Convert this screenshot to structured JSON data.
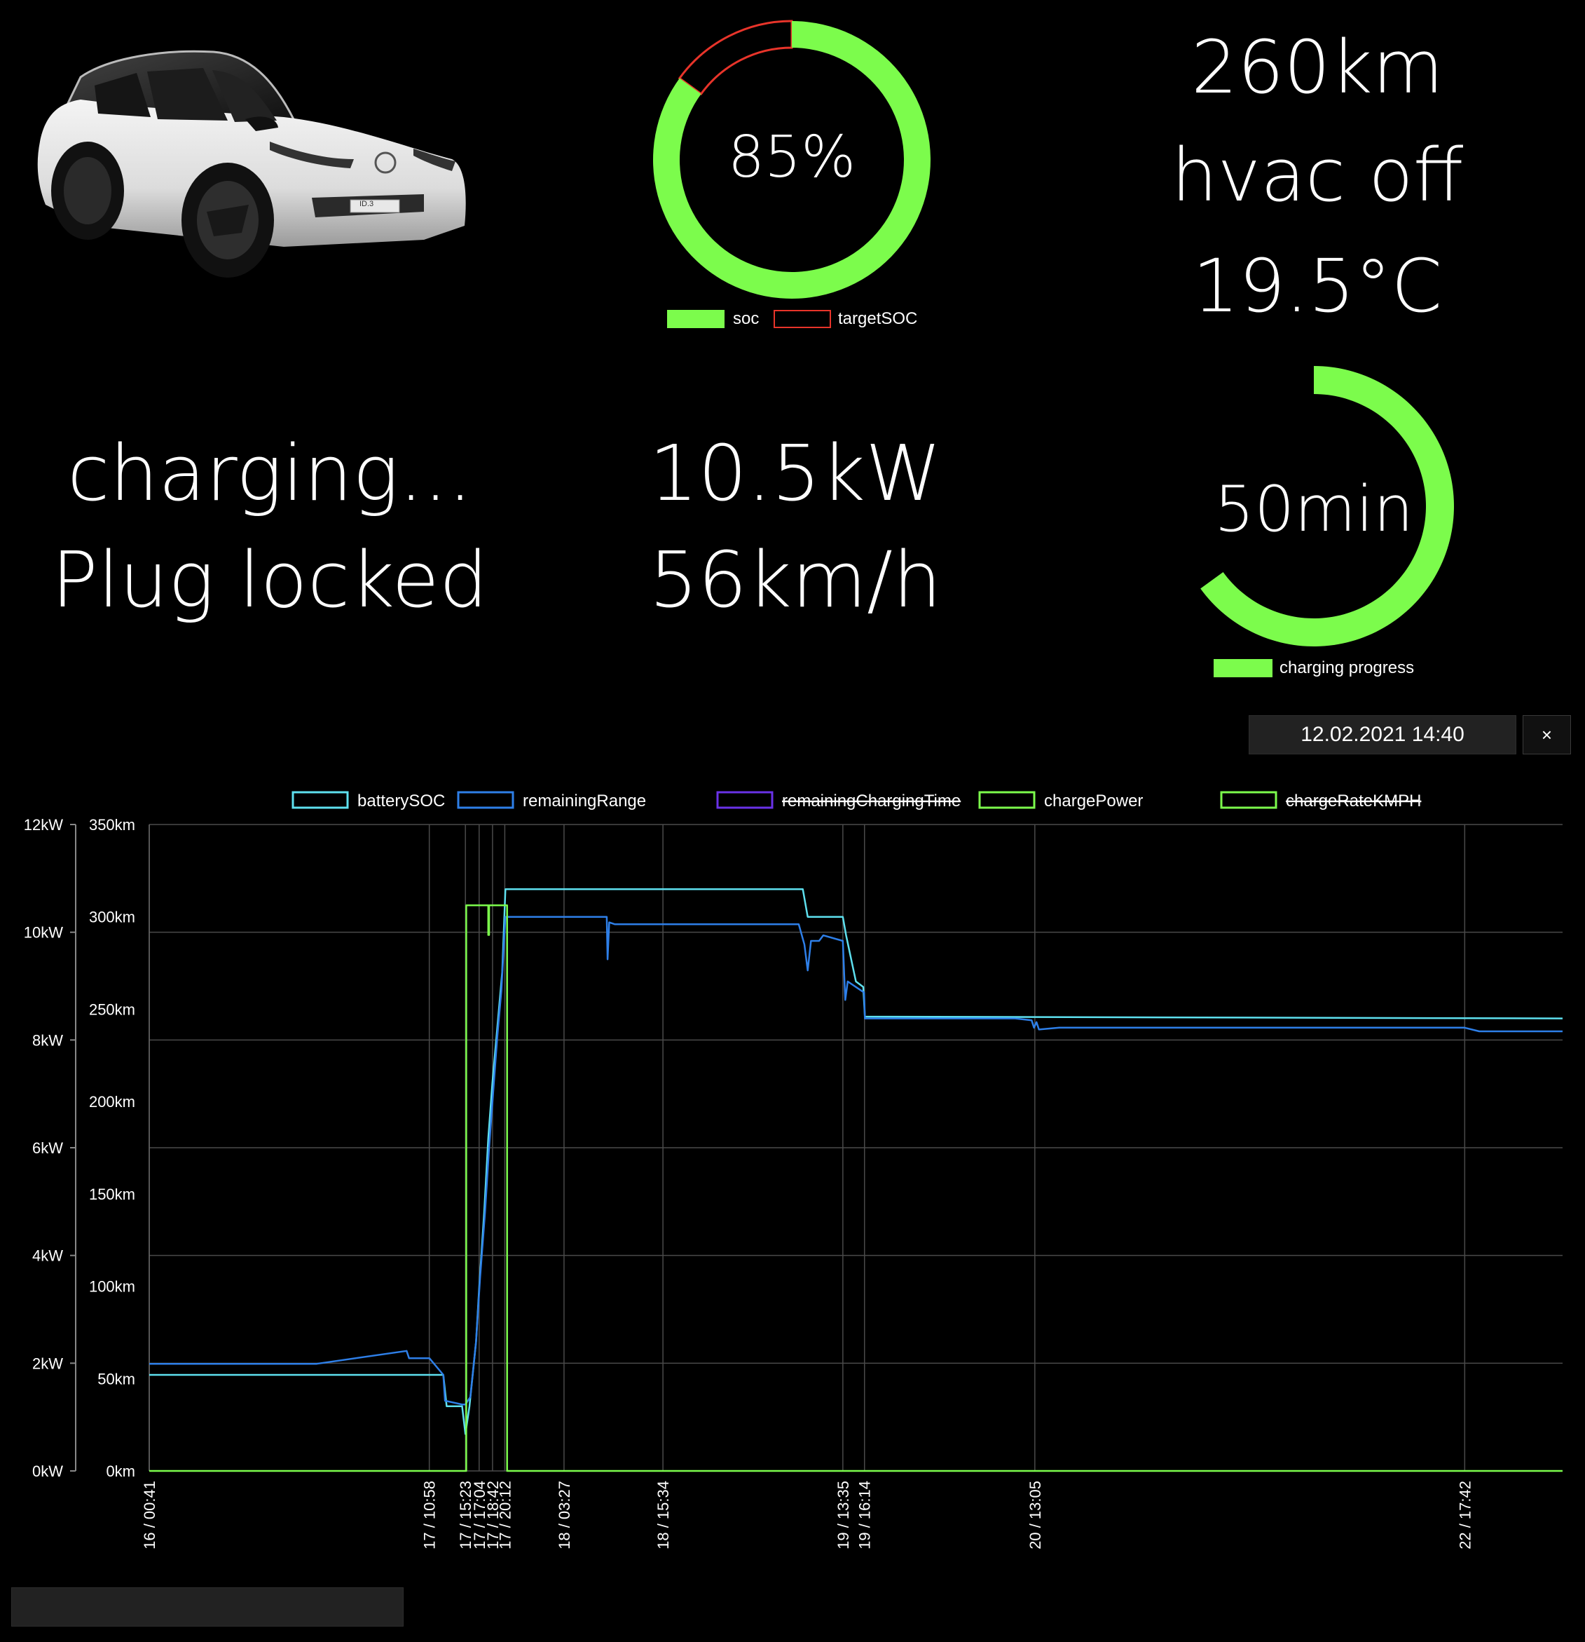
{
  "car": {
    "image_label": "ID.3"
  },
  "soc_gauge": {
    "value_text": "85%",
    "soc_percent": 85,
    "target_soc_percent": 100,
    "legend": [
      "soc",
      "targetSOC"
    ],
    "colors": {
      "soc": "#7cfc4c",
      "target": "#e8342a"
    }
  },
  "status_right": {
    "range": "260km",
    "hvac": "hvac off",
    "temperature": "19.5°C"
  },
  "charging_status": {
    "state": "charging...",
    "plug": "Plug locked"
  },
  "power": {
    "power": "10.5kW",
    "rate": "56km/h"
  },
  "progress_gauge": {
    "value_text": "50min",
    "progress_fraction": 0.65,
    "legend": "charging progress",
    "color": "#7cfc4c"
  },
  "datetime": {
    "value": "12.02.2021 14:40",
    "clear_label": "×"
  },
  "chart_data": {
    "type": "line",
    "legend": [
      {
        "name": "batterySOC",
        "color": "#5ee0ef",
        "struck": false
      },
      {
        "name": "remainingRange",
        "color": "#2e7fe8",
        "struck": false
      },
      {
        "name": "remainingChargingTime",
        "color": "#6a32e8",
        "struck": true
      },
      {
        "name": "chargePower",
        "color": "#7cfc4c",
        "struck": false
      },
      {
        "name": "chargeRateKMPH",
        "color": "#7cfc4c",
        "struck": true
      }
    ],
    "y_left": {
      "ticks": [
        "0kW",
        "2kW",
        "4kW",
        "6kW",
        "8kW",
        "10kW",
        "12kW"
      ],
      "range": [
        0,
        12
      ]
    },
    "y_right": {
      "ticks": [
        "0km",
        "50km",
        "100km",
        "150km",
        "200km",
        "250km",
        "300km",
        "350km"
      ],
      "range": [
        0,
        350
      ]
    },
    "x_ticks": [
      {
        "label": "16 / 00:41",
        "t": 0.0
      },
      {
        "label": "17 / 10:58",
        "t": 34.28
      },
      {
        "label": "17 / 15:23",
        "t": 38.7
      },
      {
        "label": "17 / 17:04",
        "t": 40.38
      },
      {
        "label": "17 / 18:42",
        "t": 42.02
      },
      {
        "label": "17 / 20:12",
        "t": 43.52
      },
      {
        "label": "18 / 03:27",
        "t": 50.77
      },
      {
        "label": "18 / 15:34",
        "t": 62.88
      },
      {
        "label": "19 / 13:35",
        "t": 84.9
      },
      {
        "label": "19 / 16:14",
        "t": 87.55
      },
      {
        "label": "20 / 13:05",
        "t": 108.4
      },
      {
        "label": "22 / 17:42",
        "t": 161.02
      }
    ],
    "x_range_hours": [
      0,
      173
    ],
    "grid": true,
    "series": [
      {
        "name": "batterySOC",
        "axis": "km",
        "points": [
          [
            0,
            52
          ],
          [
            34.3,
            52
          ],
          [
            36,
            52
          ],
          [
            36.4,
            35
          ],
          [
            38.3,
            35
          ],
          [
            38.7,
            20
          ],
          [
            39.2,
            35
          ],
          [
            40,
            70
          ],
          [
            40.4,
            100
          ],
          [
            41,
            140
          ],
          [
            41.5,
            180
          ],
          [
            42,
            210
          ],
          [
            42.6,
            240
          ],
          [
            43.2,
            270
          ],
          [
            43.6,
            315
          ],
          [
            80,
            315
          ],
          [
            80.6,
            300
          ],
          [
            84.9,
            300
          ],
          [
            85.3,
            290
          ],
          [
            86.5,
            265
          ],
          [
            87.4,
            262
          ],
          [
            87.6,
            246
          ],
          [
            173,
            245
          ]
        ]
      },
      {
        "name": "remainingRange",
        "axis": "km",
        "points": [
          [
            0,
            58
          ],
          [
            20.5,
            58
          ],
          [
            31.5,
            65
          ],
          [
            31.8,
            61
          ],
          [
            34.3,
            61
          ],
          [
            36,
            52
          ],
          [
            36.2,
            38
          ],
          [
            38.3,
            36
          ],
          [
            38.7,
            36
          ],
          [
            39.3,
            40
          ],
          [
            40,
            70
          ],
          [
            40.5,
            105
          ],
          [
            41.1,
            140
          ],
          [
            41.6,
            175
          ],
          [
            42.1,
            205
          ],
          [
            42.6,
            235
          ],
          [
            43.1,
            260
          ],
          [
            43.6,
            300
          ],
          [
            56,
            300
          ],
          [
            56.1,
            277
          ],
          [
            56.3,
            297
          ],
          [
            57,
            296
          ],
          [
            79.5,
            296
          ],
          [
            80.2,
            285
          ],
          [
            80.6,
            271
          ],
          [
            81,
            287
          ],
          [
            82,
            287
          ],
          [
            82.5,
            290
          ],
          [
            84.9,
            287
          ],
          [
            85.2,
            255
          ],
          [
            85.5,
            265
          ],
          [
            87.5,
            259
          ],
          [
            87.6,
            245
          ],
          [
            106,
            245
          ],
          [
            108,
            244
          ],
          [
            108.3,
            240
          ],
          [
            108.6,
            243
          ],
          [
            108.9,
            239
          ],
          [
            111.4,
            240
          ],
          [
            161,
            240
          ],
          [
            162.8,
            238
          ],
          [
            173,
            238
          ]
        ]
      },
      {
        "name": "chargePower",
        "axis": "kW",
        "points": [
          [
            0,
            0
          ],
          [
            38.8,
            0
          ],
          [
            38.8,
            10.5
          ],
          [
            41.5,
            10.5
          ],
          [
            41.5,
            9.95
          ],
          [
            41.6,
            9.95
          ],
          [
            41.6,
            10.5
          ],
          [
            43.8,
            10.5
          ],
          [
            43.8,
            0
          ],
          [
            173,
            0
          ]
        ]
      }
    ]
  }
}
